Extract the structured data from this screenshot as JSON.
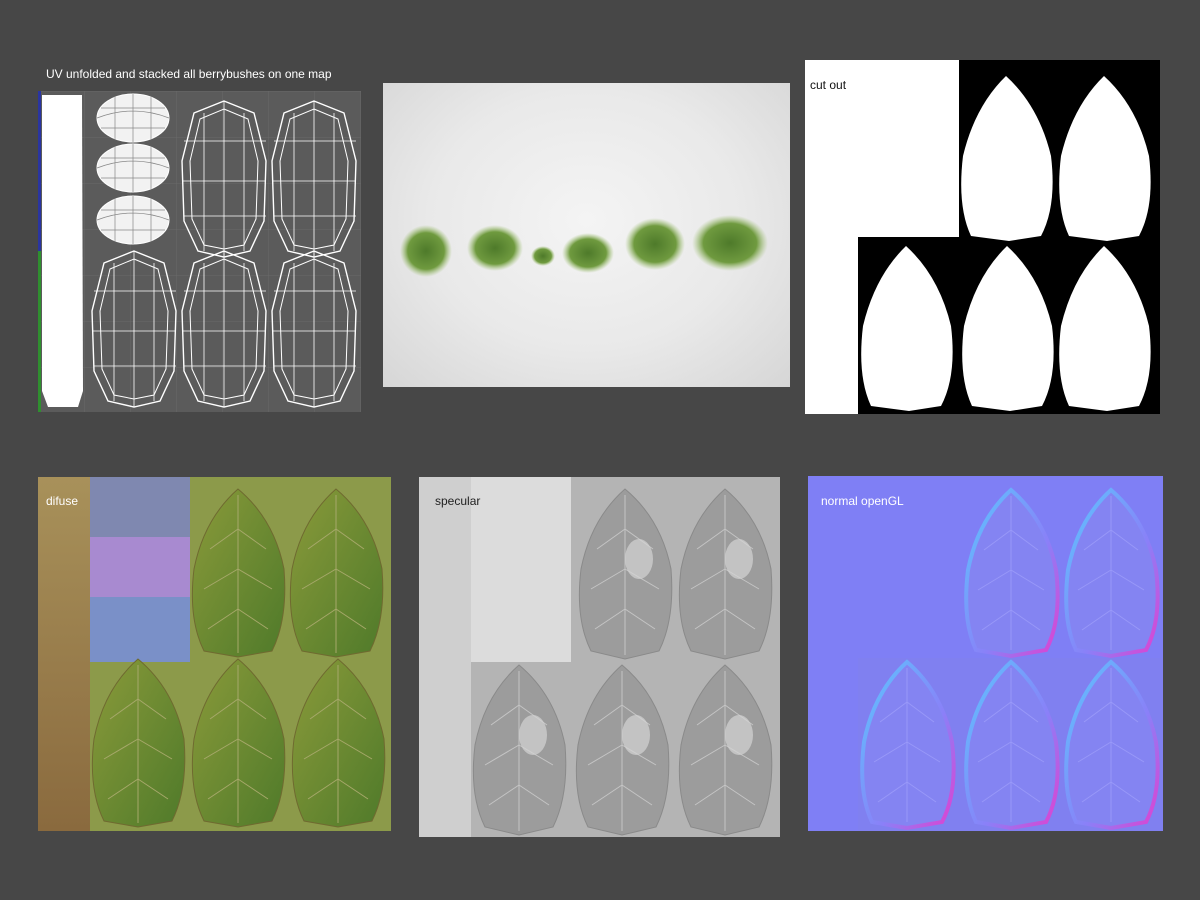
{
  "panels": {
    "uv": {
      "title": "UV unfolded and stacked  all berrybushes on one map"
    },
    "render": {},
    "cutout": {
      "label": "cut out"
    },
    "diffuse": {
      "label": "difuse"
    },
    "specular": {
      "label": "specular"
    },
    "normal": {
      "label": "normal openGL"
    }
  },
  "colors": {
    "background": "#474747",
    "normal_base": "#7f7ff5",
    "diffuse_base": "#6b7a3a",
    "specular_base": "#b8b8b8"
  }
}
